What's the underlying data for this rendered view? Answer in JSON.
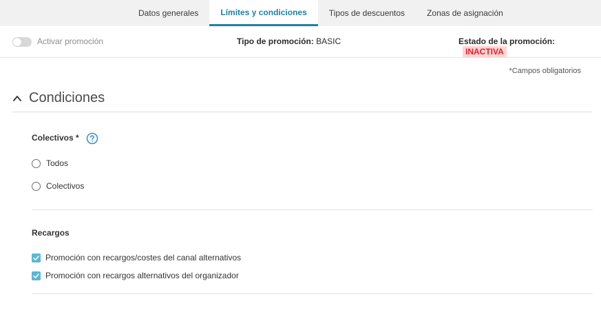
{
  "tabs": [
    {
      "label": "Datos generales",
      "active": false
    },
    {
      "label": "Límites y condiciones",
      "active": true
    },
    {
      "label": "Tipos de descuentos",
      "active": false
    },
    {
      "label": "Zonas de asignación",
      "active": false
    }
  ],
  "status": {
    "activate_label": "Activar promoción",
    "activate_on": false,
    "type_label": "Tipo de promoción:",
    "type_value": "BASIC",
    "state_label": "Estado de la promoción:",
    "state_value": "INACTIVA"
  },
  "required_note": "*Campos obligatorios",
  "section": {
    "title": "Condiciones",
    "expanded": true
  },
  "colectivos": {
    "label": "Colectivos *",
    "options": [
      {
        "label": "Todos",
        "selected": false
      },
      {
        "label": "Colectivos",
        "selected": false
      }
    ]
  },
  "recargos": {
    "label": "Recargos",
    "options": [
      {
        "label": "Promoción con recargos/costes del canal alternativos",
        "checked": true
      },
      {
        "label": "Promoción con recargos alternativos del organizador",
        "checked": true
      }
    ]
  },
  "colors": {
    "accent": "#1f7fa6",
    "checkbox": "#59b7d9",
    "inactive_badge_bg": "#ffd5d5",
    "inactive_badge_text": "#e0222a"
  }
}
